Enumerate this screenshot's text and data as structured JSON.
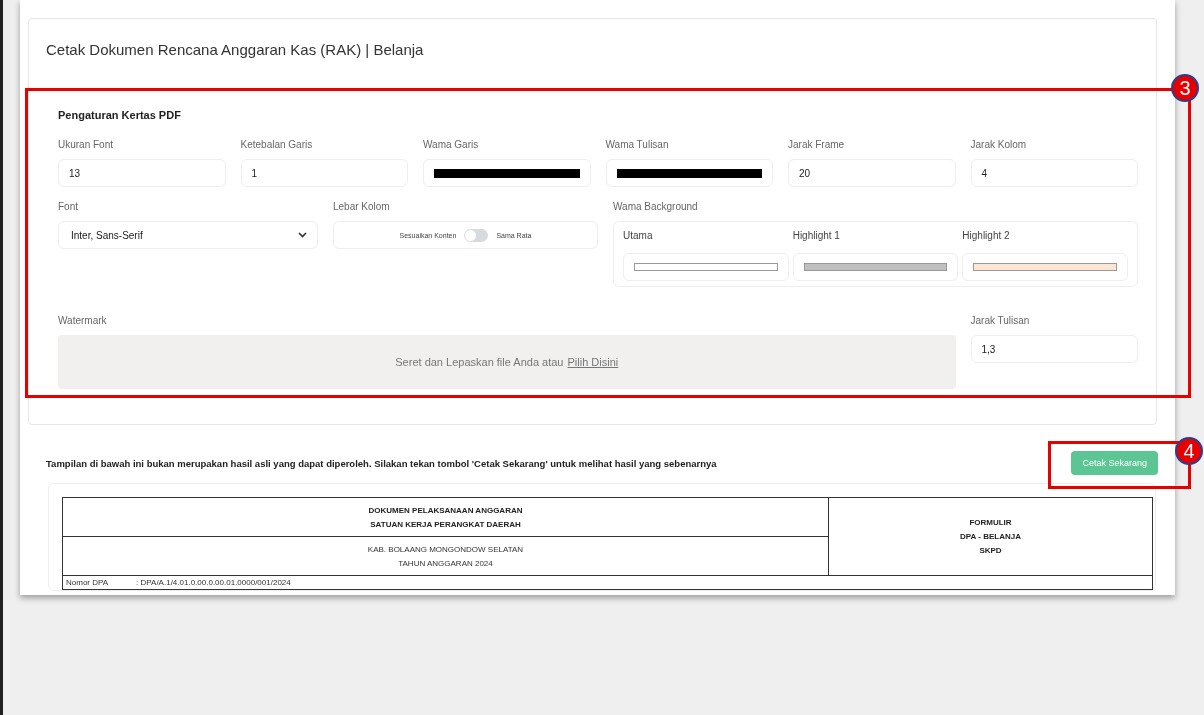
{
  "page_title": "Cetak Dokumen Rencana Anggaran Kas (RAK) | Belanja",
  "settings": {
    "title": "Pengaturan Kertas PDF",
    "fields": [
      {
        "kind": "text",
        "label": "Ukuran Font",
        "value": "13"
      },
      {
        "kind": "text",
        "label": "Ketebalan Garis",
        "value": "1"
      },
      {
        "kind": "color",
        "label": "Wama Garis",
        "color": "#000000"
      },
      {
        "kind": "color",
        "label": "Wama Tulisan",
        "color": "#000000"
      },
      {
        "kind": "text",
        "label": "Jarak Frame",
        "value": "20"
      },
      {
        "kind": "text",
        "label": "Jarak Kolom",
        "value": "4"
      }
    ],
    "font": {
      "label": "Font",
      "value": "Inter, Sans-Serif"
    },
    "column_width": {
      "label": "Lebar Kolom",
      "left": "Sesuaikan Konten",
      "right": "Sama Rata",
      "on": false
    },
    "background": {
      "label": "Wama Background",
      "swatches": [
        {
          "label": "Utama",
          "color": "#ffffff"
        },
        {
          "label": "Highlight 1",
          "color": "#c0c0c0"
        },
        {
          "label": "Highlight 2",
          "color": "#fde5d3"
        }
      ]
    },
    "watermark": {
      "label": "Watermark",
      "hint": "Seret dan Lepaskan file Anda atau",
      "link": "Pilih Disini"
    },
    "line_spacing": {
      "label": "Jarak Tulisan",
      "value": "1,3"
    }
  },
  "notice": "Tampilan di bawah ini bukan merupakan hasil asli yang dapat diperoleh. Silakan tekan tombol 'Cetak Sekarang' untuk melihat hasil yang sebenarnya",
  "print_button": "Cetak Sekarang",
  "preview": {
    "heading_1": [
      "DOKUMEN PELAKSANAAN ANGGARAN",
      "SATUAN KERJA PERANGKAT DAERAH"
    ],
    "heading_2": [
      "KAB. BOLAANG MONGONDOW SELATAN",
      "TAHUN ANGGARAN 2024"
    ],
    "form": [
      "FORMULIR",
      "DPA - BELANJA",
      "SKPD"
    ],
    "info_label": "Nomor DPA",
    "info_value": ": DPA/A.1/4.01.0.00.0.00.01.0000/001/2024"
  },
  "annotations": [
    {
      "label": "3"
    },
    {
      "label": "4"
    }
  ]
}
